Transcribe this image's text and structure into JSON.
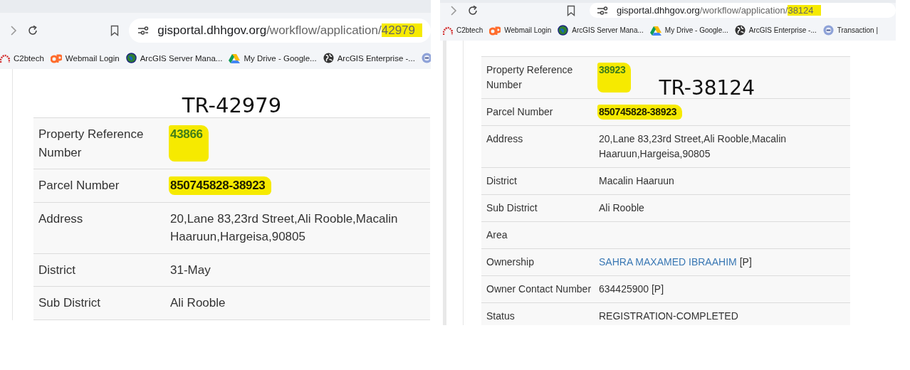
{
  "panels": [
    {
      "kind": "title-above",
      "url": {
        "host": "gisportal.dhhgov.org",
        "path": "/workflow/application/",
        "id": "42979",
        "id_highlighted": true
      },
      "bookmarks": [
        "C2btech",
        "Webmail Login",
        "ArcGIS Server Mana...",
        "My Drive - Google...",
        "ArcGIS Enterprise -..."
      ],
      "title": "TR-42979",
      "rows": [
        {
          "label": "Property Reference Number",
          "value": "43866",
          "link": true,
          "highlighted": true
        },
        {
          "label": "Parcel Number",
          "value": "850745828-38923",
          "link": false,
          "highlighted": true
        },
        {
          "label": "Address",
          "value": "20,Lane 83,23rd Street,Ali Rooble,Macalin Haaruun,Hargeisa,90805",
          "link": false,
          "highlighted": false
        },
        {
          "label": "District",
          "value": "31-May",
          "link": false,
          "highlighted": false
        },
        {
          "label": "Sub District",
          "value": "Ali Rooble",
          "link": false,
          "highlighted": false
        }
      ]
    },
    {
      "kind": "title-overlay",
      "url": {
        "host": "gisportal.dhhgov.org",
        "path": "/workflow/application/",
        "id": "38124",
        "id_highlighted": true
      },
      "bookmarks": [
        "C2btech",
        "Webmail Login",
        "ArcGIS Server Mana...",
        "My Drive - Google...",
        "ArcGIS Enterprise -...",
        "Transaction |"
      ],
      "title": "TR-38124",
      "rows": [
        {
          "label": "Property Reference Number",
          "value": "38923",
          "link": true,
          "highlighted": true
        },
        {
          "label": "Parcel Number",
          "value": "850745828-38923",
          "link": false,
          "highlighted": true
        },
        {
          "label": "Address",
          "value": "20,Lane 83,23rd Street,Ali Rooble,Macalin Haaruun,Hargeisa,90805",
          "link": false,
          "highlighted": false
        },
        {
          "label": "District",
          "value": "Macalin Haaruun",
          "link": false,
          "highlighted": false
        },
        {
          "label": "Sub District",
          "value": "Ali Rooble",
          "link": false,
          "highlighted": false
        },
        {
          "label": "Area"
        },
        {
          "label": "Ownership",
          "value": "SAHRA MAXAMED IBRAAHIM",
          "suffix": "[P]",
          "link": true,
          "highlighted": false
        },
        {
          "label": "Owner Contact Number",
          "value": "634425900 [P]",
          "link": false,
          "highlighted": false
        },
        {
          "label": "Status",
          "value": "REGISTRATION-COMPLETED",
          "link": false,
          "highlighted": false
        }
      ]
    }
  ]
}
